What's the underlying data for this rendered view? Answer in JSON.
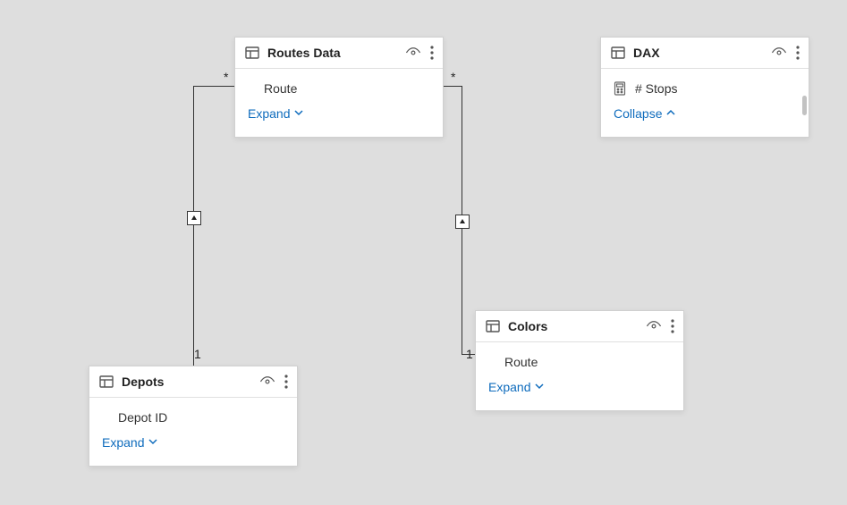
{
  "tables": {
    "routesData": {
      "title": "Routes Data",
      "fields": [
        "Route"
      ],
      "toggleLabel": "Expand"
    },
    "dax": {
      "title": "DAX",
      "fields": [
        "# Stops"
      ],
      "toggleLabel": "Collapse"
    },
    "depots": {
      "title": "Depots",
      "fields": [
        "Depot ID"
      ],
      "toggleLabel": "Expand"
    },
    "colors": {
      "title": "Colors",
      "fields": [
        "Route"
      ],
      "toggleLabel": "Expand"
    }
  },
  "relationships": {
    "depots_to_routes": {
      "fromCard": "1",
      "toCard": "*"
    },
    "colors_to_routes": {
      "fromCard": "1",
      "toCard": "*"
    }
  }
}
